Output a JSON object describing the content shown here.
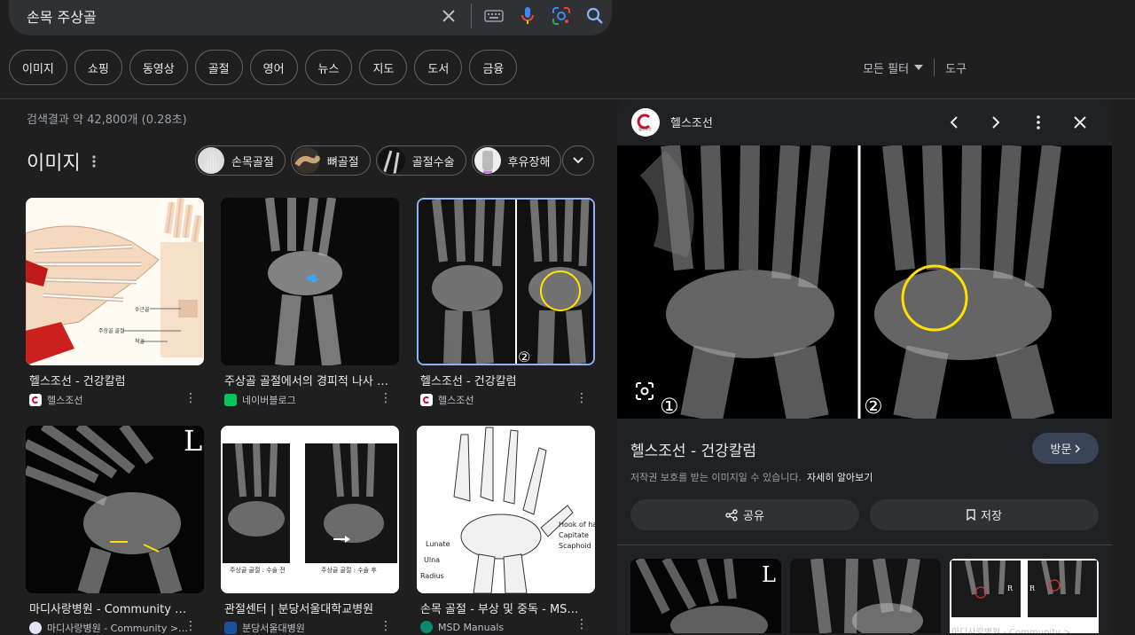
{
  "search": {
    "query": "손목 주상골"
  },
  "chips": [
    "이미지",
    "쇼핑",
    "동영상",
    "골절",
    "영어",
    "뉴스",
    "지도",
    "도서",
    "금융"
  ],
  "tools": {
    "filters": "모든 필터",
    "tools": "도구"
  },
  "stats": "검색결과 약 42,800개 (0.28초)",
  "images_section": {
    "title": "이미지"
  },
  "related": [
    "손목골절",
    "뼈골절",
    "골절수술",
    "후유장해"
  ],
  "results": [
    {
      "title": "헬스조선 - 건강칼럼",
      "source": "헬스조선"
    },
    {
      "title": "주상골 골절에서의 경피적 나사 …",
      "source": "네이버블로그"
    },
    {
      "title": "헬스조선 - 건강칼럼",
      "source": "헬스조선"
    },
    {
      "title": "마디사랑병원 - Community > Blog",
      "source": "마디사랑병원 - Community >…"
    },
    {
      "title": "관절센터 | 분당서울대학교병원",
      "source": "분당서울대병원"
    },
    {
      "title": "손목 골절 - 부상 및 중독 - MSD …",
      "source": "MSD Manuals"
    }
  ],
  "image_labels": {
    "thumb1": [
      "수근골",
      "주상골 골절",
      "척골"
    ],
    "thumb5": [
      "주상골 골절 : 수술 전",
      "주상골 골절 : 수술 후"
    ],
    "thumb6": [
      "Hook of hamate",
      "Capitate",
      "Scaphoid",
      "Lunate",
      "Ulna",
      "Radius"
    ],
    "circled_one": "①",
    "circled_two": "②",
    "letter_l": "L",
    "letter_r": "R",
    "logo_text": "헬스조선"
  },
  "panel": {
    "source_name": "헬스조선",
    "title": "헬스조선 - 건강칼럼",
    "visit": "방문",
    "copyright": "저작권 보호를 받는 이미지일 수 있습니다.",
    "learn_more": "자세히 알아보기",
    "share": "공유",
    "save": "저장",
    "related_caption": "마디사랑병원 - Community >…"
  },
  "colors": {
    "background": "#1f1f1f",
    "accent_blue": "#8ab4f8",
    "mic_red": "#ea4335",
    "yellow_circle": "#ffe100"
  }
}
